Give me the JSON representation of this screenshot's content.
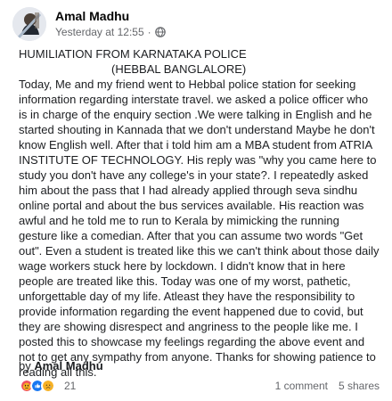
{
  "post": {
    "author": "Amal Madhu",
    "timestamp": "Yesterday at 12:55",
    "privacy_icon": "globe-icon",
    "title": "HUMILIATION FROM KARNATAKA POLICE",
    "subtitle": "(HEBBAL BANGLALORE)",
    "body": "Today, Me and my friend went to Hebbal police station for seeking information regarding interstate travel. we asked a police officer who is in charge of the enquiry section .We were talking in English and  he started shouting in Kannada that we don't understand Maybe he don't know English well. After that i told him am a MBA student from ATRIA INSTITUTE OF TECHNOLOGY. His reply was \"why you came here to study you don't have any college's in your state?. I repeatedly asked him about the pass that I had already applied through seva sindhu online portal and about the bus services available. His reaction was awful and he told me to run to Kerala by mimicking the running gesture like a comedian. After that you can assume two words \"Get out\". Even a student is treated like this  we can't think about those daily wage workers stuck here by lockdown. I didn't know that in here people are treated like this. Today was one of my worst, pathetic, unforgettable day of my life. Atleast they have the responsibility to provide information regarding the event happened due to covid, but they are showing disrespect and angriness to the people like me. I posted this to showcase my feelings regarding the above event and not to get any sympathy from anyone. Thanks for showing patience to reading all this.",
    "signature_prefix": "by",
    "signature_name": "Amal Madhu"
  },
  "footer": {
    "reaction_count": "21",
    "comments": "1 comment",
    "shares": "5 shares",
    "reaction_icons": [
      "angry-reaction-icon",
      "like-reaction-icon",
      "sad-reaction-icon"
    ]
  },
  "colors": {
    "text": "#1c1e21",
    "muted": "#65676b",
    "like": "#1877f2",
    "angry": "#f04f5d",
    "sad": "#f7b125"
  }
}
